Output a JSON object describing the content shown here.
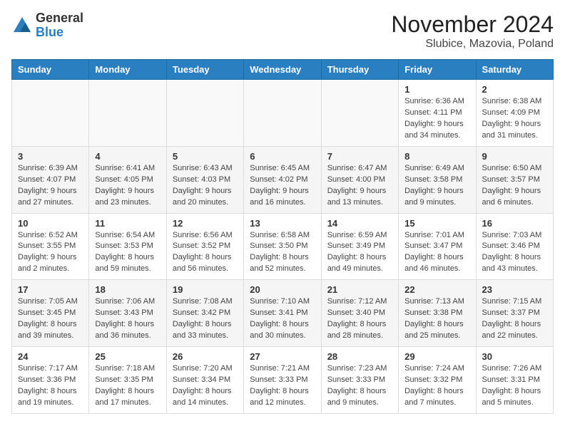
{
  "header": {
    "logo_general": "General",
    "logo_blue": "Blue",
    "title": "November 2024",
    "subtitle": "Slubice, Mazovia, Poland"
  },
  "days_of_week": [
    "Sunday",
    "Monday",
    "Tuesday",
    "Wednesday",
    "Thursday",
    "Friday",
    "Saturday"
  ],
  "weeks": [
    [
      {
        "day": "",
        "sunrise": "",
        "sunset": "",
        "daylight": ""
      },
      {
        "day": "",
        "sunrise": "",
        "sunset": "",
        "daylight": ""
      },
      {
        "day": "",
        "sunrise": "",
        "sunset": "",
        "daylight": ""
      },
      {
        "day": "",
        "sunrise": "",
        "sunset": "",
        "daylight": ""
      },
      {
        "day": "",
        "sunrise": "",
        "sunset": "",
        "daylight": ""
      },
      {
        "day": "1",
        "sunrise": "Sunrise: 6:36 AM",
        "sunset": "Sunset: 4:11 PM",
        "daylight": "Daylight: 9 hours and 34 minutes."
      },
      {
        "day": "2",
        "sunrise": "Sunrise: 6:38 AM",
        "sunset": "Sunset: 4:09 PM",
        "daylight": "Daylight: 9 hours and 31 minutes."
      }
    ],
    [
      {
        "day": "3",
        "sunrise": "Sunrise: 6:39 AM",
        "sunset": "Sunset: 4:07 PM",
        "daylight": "Daylight: 9 hours and 27 minutes."
      },
      {
        "day": "4",
        "sunrise": "Sunrise: 6:41 AM",
        "sunset": "Sunset: 4:05 PM",
        "daylight": "Daylight: 9 hours and 23 minutes."
      },
      {
        "day": "5",
        "sunrise": "Sunrise: 6:43 AM",
        "sunset": "Sunset: 4:03 PM",
        "daylight": "Daylight: 9 hours and 20 minutes."
      },
      {
        "day": "6",
        "sunrise": "Sunrise: 6:45 AM",
        "sunset": "Sunset: 4:02 PM",
        "daylight": "Daylight: 9 hours and 16 minutes."
      },
      {
        "day": "7",
        "sunrise": "Sunrise: 6:47 AM",
        "sunset": "Sunset: 4:00 PM",
        "daylight": "Daylight: 9 hours and 13 minutes."
      },
      {
        "day": "8",
        "sunrise": "Sunrise: 6:49 AM",
        "sunset": "Sunset: 3:58 PM",
        "daylight": "Daylight: 9 hours and 9 minutes."
      },
      {
        "day": "9",
        "sunrise": "Sunrise: 6:50 AM",
        "sunset": "Sunset: 3:57 PM",
        "daylight": "Daylight: 9 hours and 6 minutes."
      }
    ],
    [
      {
        "day": "10",
        "sunrise": "Sunrise: 6:52 AM",
        "sunset": "Sunset: 3:55 PM",
        "daylight": "Daylight: 9 hours and 2 minutes."
      },
      {
        "day": "11",
        "sunrise": "Sunrise: 6:54 AM",
        "sunset": "Sunset: 3:53 PM",
        "daylight": "Daylight: 8 hours and 59 minutes."
      },
      {
        "day": "12",
        "sunrise": "Sunrise: 6:56 AM",
        "sunset": "Sunset: 3:52 PM",
        "daylight": "Daylight: 8 hours and 56 minutes."
      },
      {
        "day": "13",
        "sunrise": "Sunrise: 6:58 AM",
        "sunset": "Sunset: 3:50 PM",
        "daylight": "Daylight: 8 hours and 52 minutes."
      },
      {
        "day": "14",
        "sunrise": "Sunrise: 6:59 AM",
        "sunset": "Sunset: 3:49 PM",
        "daylight": "Daylight: 8 hours and 49 minutes."
      },
      {
        "day": "15",
        "sunrise": "Sunrise: 7:01 AM",
        "sunset": "Sunset: 3:47 PM",
        "daylight": "Daylight: 8 hours and 46 minutes."
      },
      {
        "day": "16",
        "sunrise": "Sunrise: 7:03 AM",
        "sunset": "Sunset: 3:46 PM",
        "daylight": "Daylight: 8 hours and 43 minutes."
      }
    ],
    [
      {
        "day": "17",
        "sunrise": "Sunrise: 7:05 AM",
        "sunset": "Sunset: 3:45 PM",
        "daylight": "Daylight: 8 hours and 39 minutes."
      },
      {
        "day": "18",
        "sunrise": "Sunrise: 7:06 AM",
        "sunset": "Sunset: 3:43 PM",
        "daylight": "Daylight: 8 hours and 36 minutes."
      },
      {
        "day": "19",
        "sunrise": "Sunrise: 7:08 AM",
        "sunset": "Sunset: 3:42 PM",
        "daylight": "Daylight: 8 hours and 33 minutes."
      },
      {
        "day": "20",
        "sunrise": "Sunrise: 7:10 AM",
        "sunset": "Sunset: 3:41 PM",
        "daylight": "Daylight: 8 hours and 30 minutes."
      },
      {
        "day": "21",
        "sunrise": "Sunrise: 7:12 AM",
        "sunset": "Sunset: 3:40 PM",
        "daylight": "Daylight: 8 hours and 28 minutes."
      },
      {
        "day": "22",
        "sunrise": "Sunrise: 7:13 AM",
        "sunset": "Sunset: 3:38 PM",
        "daylight": "Daylight: 8 hours and 25 minutes."
      },
      {
        "day": "23",
        "sunrise": "Sunrise: 7:15 AM",
        "sunset": "Sunset: 3:37 PM",
        "daylight": "Daylight: 8 hours and 22 minutes."
      }
    ],
    [
      {
        "day": "24",
        "sunrise": "Sunrise: 7:17 AM",
        "sunset": "Sunset: 3:36 PM",
        "daylight": "Daylight: 8 hours and 19 minutes."
      },
      {
        "day": "25",
        "sunrise": "Sunrise: 7:18 AM",
        "sunset": "Sunset: 3:35 PM",
        "daylight": "Daylight: 8 hours and 17 minutes."
      },
      {
        "day": "26",
        "sunrise": "Sunrise: 7:20 AM",
        "sunset": "Sunset: 3:34 PM",
        "daylight": "Daylight: 8 hours and 14 minutes."
      },
      {
        "day": "27",
        "sunrise": "Sunrise: 7:21 AM",
        "sunset": "Sunset: 3:33 PM",
        "daylight": "Daylight: 8 hours and 12 minutes."
      },
      {
        "day": "28",
        "sunrise": "Sunrise: 7:23 AM",
        "sunset": "Sunset: 3:33 PM",
        "daylight": "Daylight: 8 hours and 9 minutes."
      },
      {
        "day": "29",
        "sunrise": "Sunrise: 7:24 AM",
        "sunset": "Sunset: 3:32 PM",
        "daylight": "Daylight: 8 hours and 7 minutes."
      },
      {
        "day": "30",
        "sunrise": "Sunrise: 7:26 AM",
        "sunset": "Sunset: 3:31 PM",
        "daylight": "Daylight: 8 hours and 5 minutes."
      }
    ]
  ]
}
